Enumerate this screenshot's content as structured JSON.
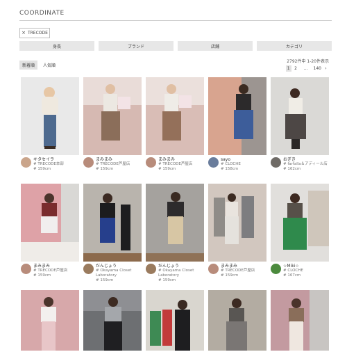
{
  "header": {
    "title": "COORDINATE"
  },
  "active_filter": {
    "label": "TRECODE"
  },
  "filters": [
    {
      "label": "身長"
    },
    {
      "label": "ブランド"
    },
    {
      "label": "店舗"
    },
    {
      "label": "カテゴリ"
    }
  ],
  "sort": {
    "newest": "新着順",
    "popular": "人気順"
  },
  "results": {
    "count_text": "2792件中 1-20件表示"
  },
  "pagination": {
    "p1": "1",
    "p2": "2",
    "ellipsis": "…",
    "last": "140",
    "next": "›"
  },
  "cards": [
    {
      "name": "キタセイラ",
      "store": "# TRECODE本部",
      "height": "# 159cm",
      "bg": "#e9e9e9",
      "avatar": "#caa58b"
    },
    {
      "name": "まみまみ",
      "store": "# TRECODE芦屋店",
      "height": "# 159cm",
      "bg": "#d6b9b2",
      "avatar": "#b88c7b"
    },
    {
      "name": "まみまみ",
      "store": "# TRECODE芦屋店",
      "height": "# 159cm",
      "bg": "#d9bdb6",
      "avatar": "#b88c7b"
    },
    {
      "name": "sayo",
      "store": "# CLOCHE",
      "height": "# 158cm",
      "bg": "#d8a48f",
      "avatar": "#6a7d9c"
    },
    {
      "name": "おぎき",
      "store": "# farfalla＆アディール店",
      "height": "# 162cm",
      "bg": "#dad9d6",
      "avatar": "#6f6b66"
    },
    {
      "name": "まみまみ",
      "store": "# TRECODE芦屋店",
      "height": "# 159cm",
      "bg": "#dea2a7",
      "avatar": "#b88c7b"
    },
    {
      "name": "だんじょう",
      "store": "# Okayama Closet Laboratory",
      "height": "# 159cm",
      "bg": "#b9b4ad",
      "avatar": "#9a7b5e"
    },
    {
      "name": "だんじょう",
      "store": "# Okayama Closet Laboratory",
      "height": "# 159cm",
      "bg": "#a5a29e",
      "avatar": "#9a7b5e"
    },
    {
      "name": "まみまみ",
      "store": "# TRECODE芦屋店",
      "height": "# 159cm",
      "bg": "#d2c7bf",
      "avatar": "#b88c7b"
    },
    {
      "name": "☆Miki☆",
      "store": "# CLOCHE",
      "height": "# 167cm",
      "bg": "#e1dfdc",
      "avatar": "#4b8a3d"
    },
    {
      "bg": "#d7a8aa"
    },
    {
      "bg": "#6d6f72"
    },
    {
      "bg": "#d9d6cf"
    },
    {
      "bg": "#b3aca2"
    },
    {
      "bg": "#c39aa0"
    }
  ]
}
